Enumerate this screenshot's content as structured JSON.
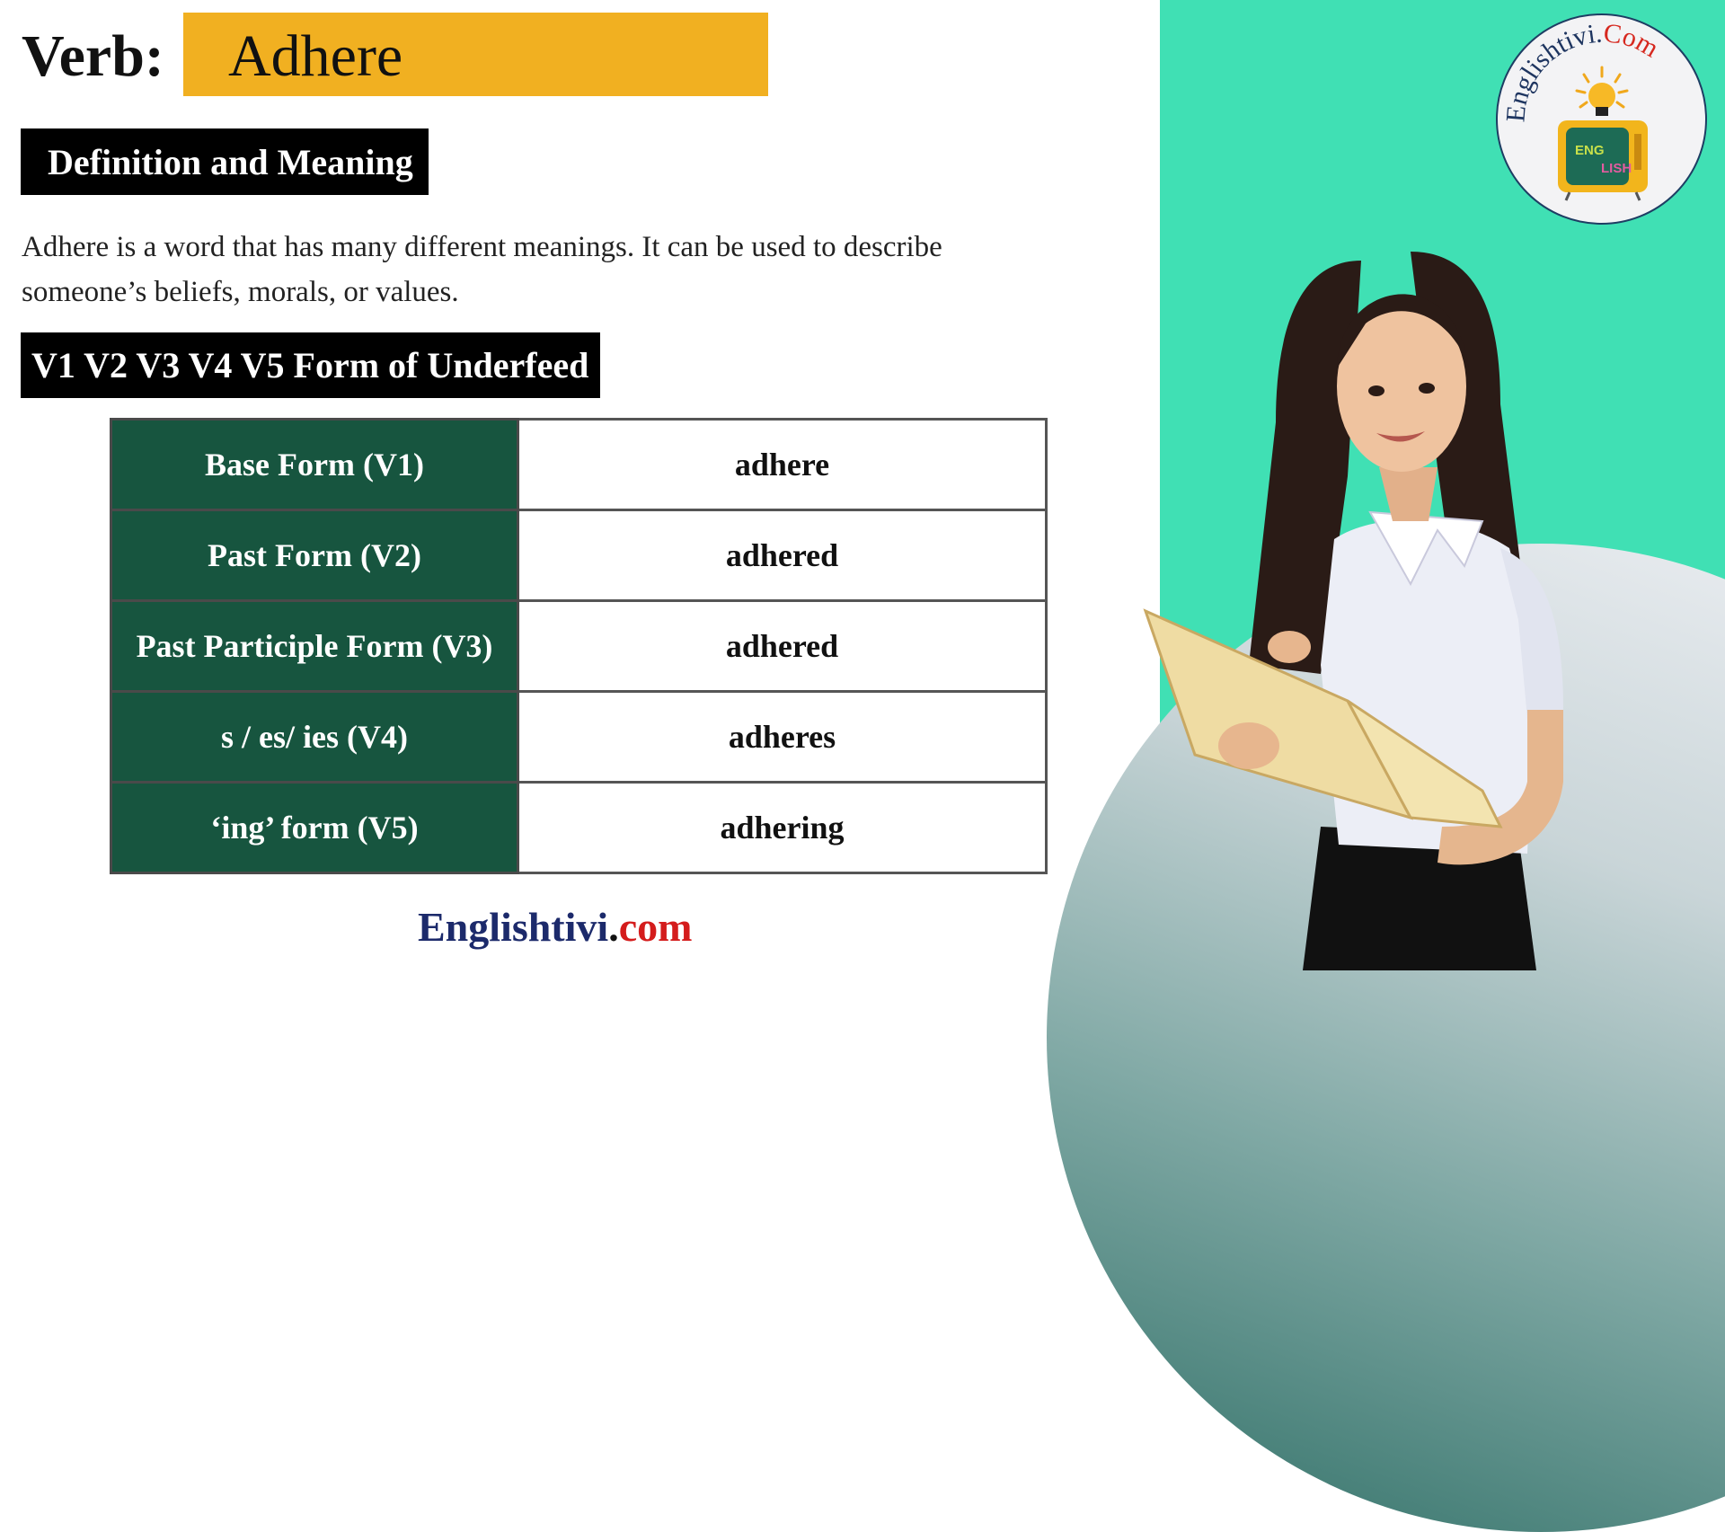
{
  "header": {
    "verb_label": "Verb:",
    "verb_word": "Adhere"
  },
  "definition": {
    "tag": "Definition and Meaning",
    "text": "Adhere is a word that has many different meanings. It can be used to describe someone’s beliefs, morals, or values."
  },
  "forms_section": {
    "tag": "V1 V2 V3 V4 V5 Form of Underfeed",
    "rows": [
      {
        "label": "Base Form (V1)",
        "value": "adhere"
      },
      {
        "label": "Past Form (V2)",
        "value": "adhered"
      },
      {
        "label": "Past Participle Form (V3)",
        "value": "adhered"
      },
      {
        "label": "s / es/ ies (V4)",
        "value": "adheres"
      },
      {
        "label": "‘ing’ form (V5)",
        "value": "adhering"
      }
    ]
  },
  "footer": {
    "brand_main": "Englishtivi",
    "brand_dot": ".",
    "brand_tld": "com"
  },
  "logo": {
    "text_main": "Englishtivi.",
    "text_tld": "Com",
    "icon": "tv-lightbulb-icon"
  },
  "colors": {
    "accent_yellow": "#f1b021",
    "table_green": "#17553f",
    "teal_panel": "#40e0b4",
    "brand_navy": "#1c2a6b",
    "brand_red": "#d41c1c"
  }
}
